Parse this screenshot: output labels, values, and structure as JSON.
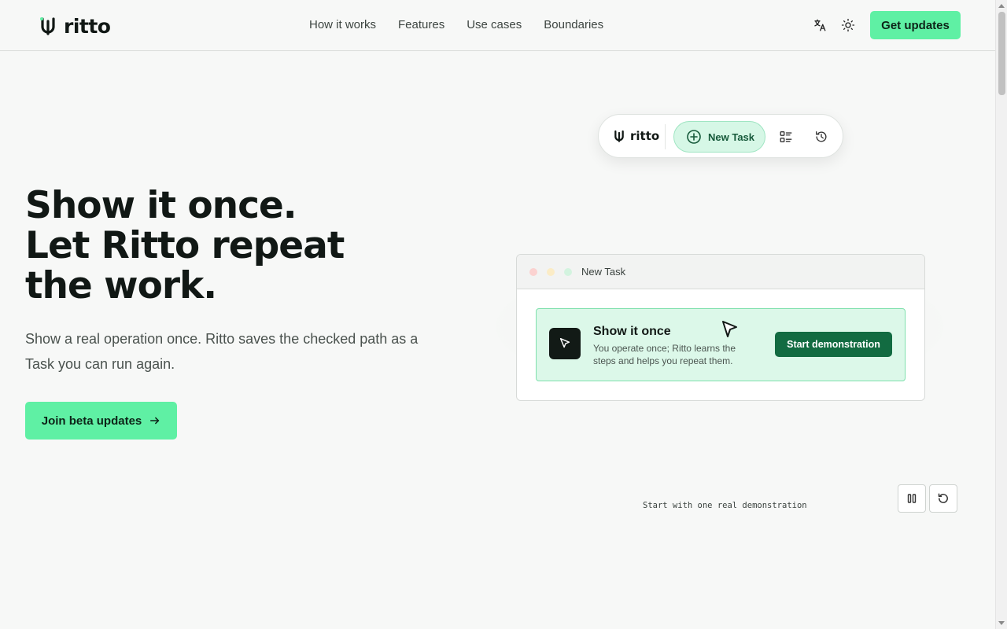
{
  "brand": {
    "name": "ritto"
  },
  "nav": {
    "items": [
      "How it works",
      "Features",
      "Use cases",
      "Boundaries"
    ]
  },
  "header": {
    "language_icon": "translate-icon",
    "theme_icon": "sun-icon",
    "cta_label": "Get updates"
  },
  "hero": {
    "title_lines": [
      "Show it once.",
      "Let Ritto repeat",
      "the work."
    ],
    "subtitle": "Show a real operation once. Ritto saves the checked path as a Task you can run again.",
    "cta_label": "Join beta updates"
  },
  "toolbar": {
    "logo_text": "ritto",
    "new_task_label": "New Task",
    "icons": [
      "list-icon",
      "history-icon"
    ]
  },
  "window": {
    "title": "New Task",
    "card": {
      "title": "Show it once",
      "description": "You operate once; Ritto learns the steps and helps you repeat them.",
      "button_label": "Start demonstration"
    }
  },
  "demo": {
    "caption": "Start with one real demonstration",
    "controls": [
      "pause-icon",
      "restart-icon"
    ]
  },
  "colors": {
    "accent": "#5ff0a4",
    "accent_dark": "#126b41",
    "card_bg": "#dcf8e9",
    "text": "#111815",
    "background": "#f7f8f7"
  }
}
